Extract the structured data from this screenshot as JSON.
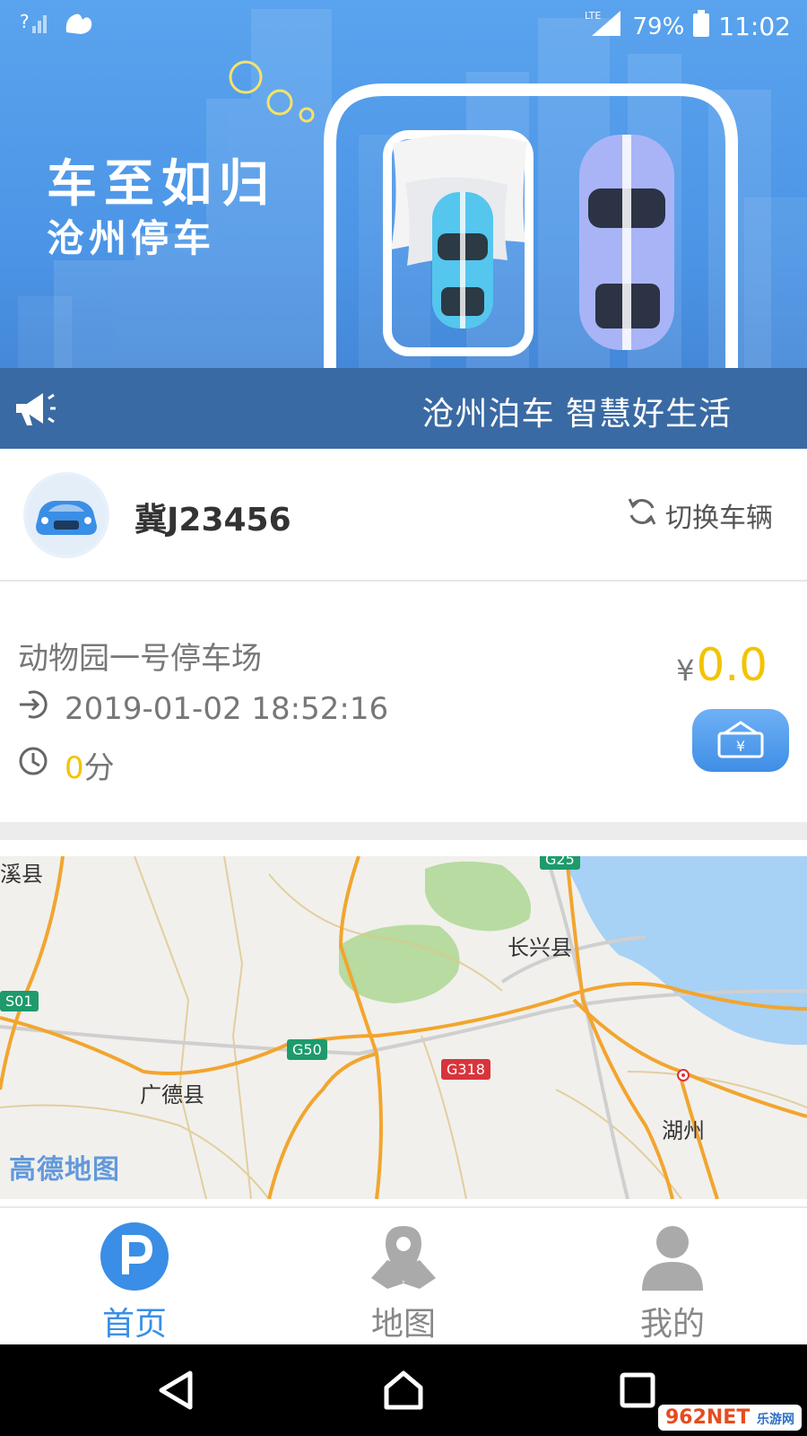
{
  "status_bar": {
    "battery": "79%",
    "time": "11:02",
    "network": "LTE"
  },
  "banner": {
    "slogan_main": "车至如归",
    "slogan_sub": "沧州停车",
    "notice_text": "沧州泊车 智慧好生活"
  },
  "vehicle": {
    "plate": "冀J23456",
    "switch_label": "切换车辆"
  },
  "parking": {
    "lot_name": "动物园一号停车场",
    "entry_time": "2019-01-02 18:52:16",
    "duration_value": "0",
    "duration_unit": "分",
    "currency": "¥",
    "amount": "0.0"
  },
  "map": {
    "places": [
      "长兴县",
      "广德县",
      "湖州",
      "溪县"
    ],
    "shields": [
      "S01",
      "G50",
      "G318",
      "G25"
    ],
    "provider_logo": "高德地图"
  },
  "tabs": [
    {
      "label": "首页",
      "icon": "parking-icon",
      "active": true
    },
    {
      "label": "地图",
      "icon": "map-pin-icon",
      "active": false
    },
    {
      "label": "我的",
      "icon": "user-icon",
      "active": false
    }
  ],
  "watermark": {
    "text": "962NET",
    "sub": "乐游网"
  },
  "colors": {
    "accent": "#3a8ee6",
    "price": "#f3c300",
    "notice_bar": "#3a6aa3"
  }
}
